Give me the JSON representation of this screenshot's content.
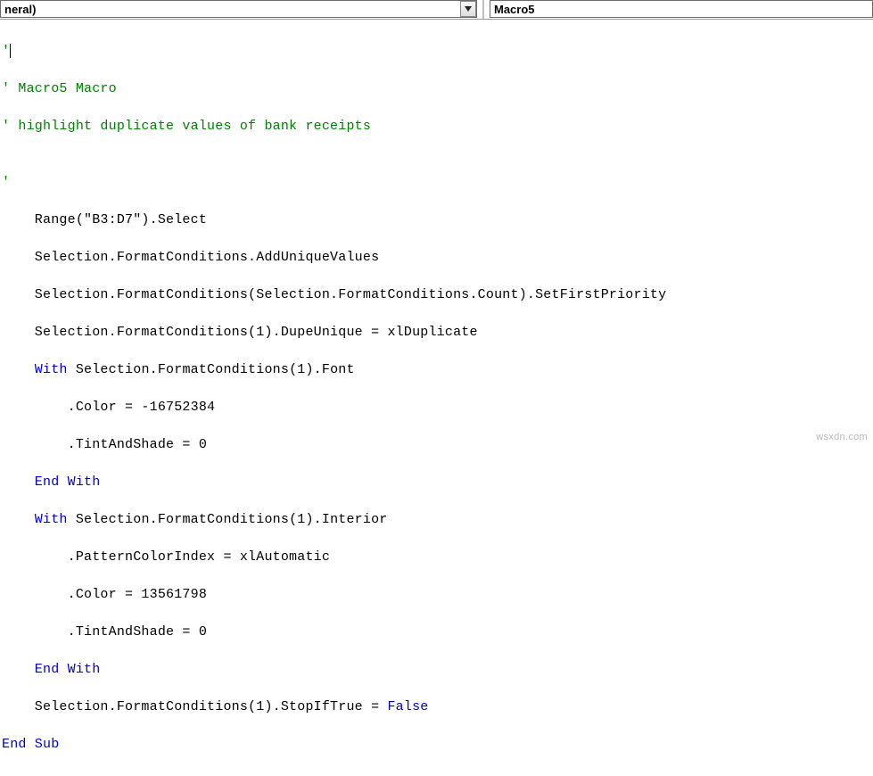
{
  "toolbar": {
    "object_dropdown": {
      "text": "neral)"
    },
    "procedure_dropdown": {
      "text": "Macro5"
    }
  },
  "code": {
    "l01": "'",
    "l02_prefix": "'",
    "l02_text": " Macro5 Macro",
    "l03_prefix": "'",
    "l03_text": " highlight duplicate values of bank receipts",
    "l04": "",
    "l05": "'",
    "l06": "    Range(\"B3:D7\").Select",
    "l07": "    Selection.FormatConditions.AddUniqueValues",
    "l08": "    Selection.FormatConditions(Selection.FormatConditions.Count).SetFirstPriority",
    "l09": "    Selection.FormatConditions(1).DupeUnique = xlDuplicate",
    "l10_k1": "    With",
    "l10_t1": " Selection.FormatConditions(1).Font",
    "l11": "        .Color = -16752384",
    "l12": "        .TintAndShade = 0",
    "l13_k1": "    End With",
    "l14_k1": "    With",
    "l14_t1": " Selection.FormatConditions(1).Interior",
    "l15": "        .PatternColorIndex = xlAutomatic",
    "l16": "        .Color = 13561798",
    "l17": "        .TintAndShade = 0",
    "l18_k1": "    End With",
    "l19_t1": "    Selection.FormatConditions(1).StopIfTrue = ",
    "l19_k1": "False",
    "l20_k1": "End Sub"
  },
  "watermark": "wsxdn.com"
}
